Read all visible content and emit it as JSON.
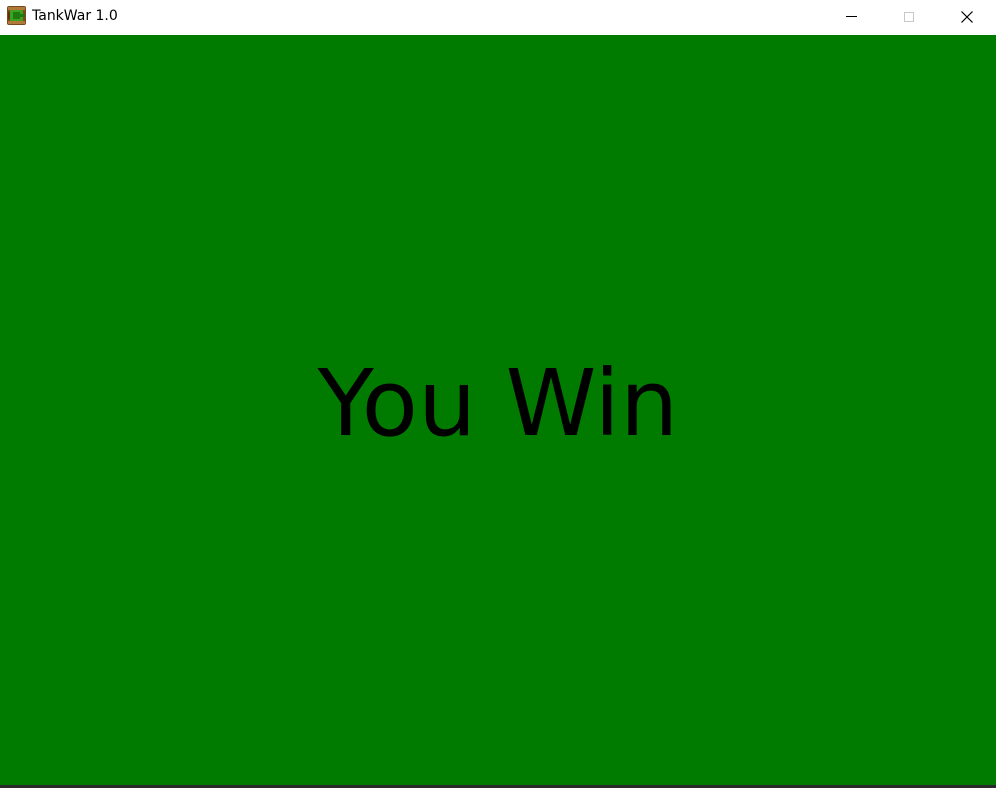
{
  "window": {
    "title": "TankWar 1.0",
    "icon": "tank-icon",
    "controls": {
      "minimize": "minimize-icon",
      "maximize": "maximize-icon",
      "close": "close-icon"
    }
  },
  "game": {
    "message": "You Win"
  },
  "colors": {
    "game_background": "#007b00",
    "message_text": "#000000",
    "titlebar_background": "#ffffff"
  }
}
